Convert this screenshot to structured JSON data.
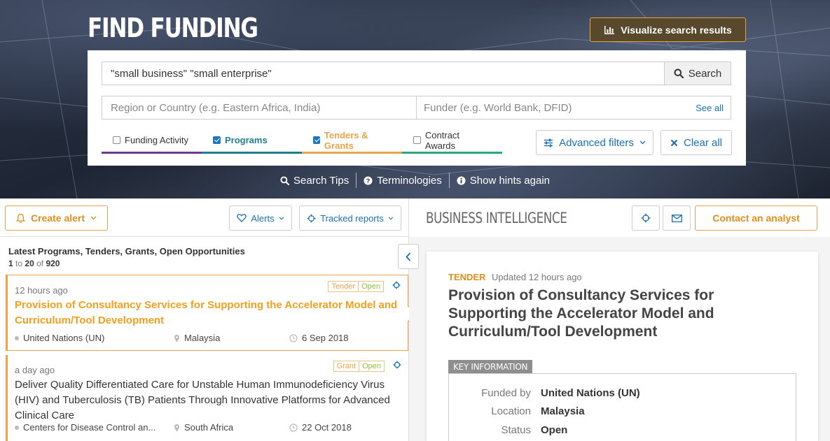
{
  "hero": {
    "title": "FIND FUNDING",
    "visualize_label": "Visualize search results"
  },
  "search": {
    "query": "\"small business\" \"small enterprise\"",
    "search_label": "Search",
    "region_placeholder": "Region or Country (e.g. Eastern Africa, India)",
    "funder_placeholder": "Funder (e.g. World Bank, DFID)",
    "see_all": "See all",
    "types": [
      {
        "label": "Funding Activity",
        "checked": false
      },
      {
        "label": "Programs",
        "checked": true
      },
      {
        "label": "Tenders & Grants",
        "checked": true
      },
      {
        "label": "Contract Awards",
        "checked": false
      }
    ],
    "advanced_label": "Advanced filters",
    "clear_label": "Clear all"
  },
  "hints": {
    "tips": "Search Tips",
    "terminologies": "Terminologies",
    "show_hints": "Show hints again"
  },
  "toolbar": {
    "create_alert": "Create alert",
    "alerts": "Alerts",
    "tracked_reports": "Tracked reports",
    "bi_title": "BUSINESS INTELLIGENCE",
    "contact": "Contact an analyst"
  },
  "list": {
    "heading": "Latest Programs, Tenders, Grants, Open Opportunities",
    "range_start": "1",
    "range_to": "to",
    "range_end": "20",
    "range_of": "of",
    "total": "920",
    "items": [
      {
        "time": "12 hours ago",
        "type": "Tender",
        "status": "Open",
        "title": "Provision of Consultancy Services for Supporting the Accelerator Model and Curriculum/Tool Development",
        "funder": "United Nations (UN)",
        "location": "Malaysia",
        "date": "6 Sep 2018"
      },
      {
        "time": "a day ago",
        "type": "Grant",
        "status": "Open",
        "title": "Deliver Quality Differentiated Care for Unstable Human Immunodeficiency Virus (HIV) and Tuberculosis (TB) Patients Through Innovative Platforms for Advanced Clinical Care",
        "funder": "Centers for Disease Control an...",
        "location": "South Africa",
        "date": "22 Oct 2018"
      }
    ]
  },
  "detail": {
    "type": "TENDER",
    "updated": "Updated 12 hours ago",
    "title": "Provision of Consultancy Services for Supporting the Accelerator Model and Curriculum/Tool Development",
    "key_info_label": "KEY INFORMATION",
    "rows": [
      {
        "label": "Funded by",
        "value": "United Nations (UN)"
      },
      {
        "label": "Location",
        "value": "Malaysia"
      },
      {
        "label": "Status",
        "value": "Open"
      }
    ]
  },
  "colors": {
    "accent_orange": "#e9a34b",
    "link_blue": "#1a6fb3",
    "programs_teal": "#1d7e8e",
    "funding_purple": "#6a3b8f",
    "awards_green": "#2aa77e"
  }
}
